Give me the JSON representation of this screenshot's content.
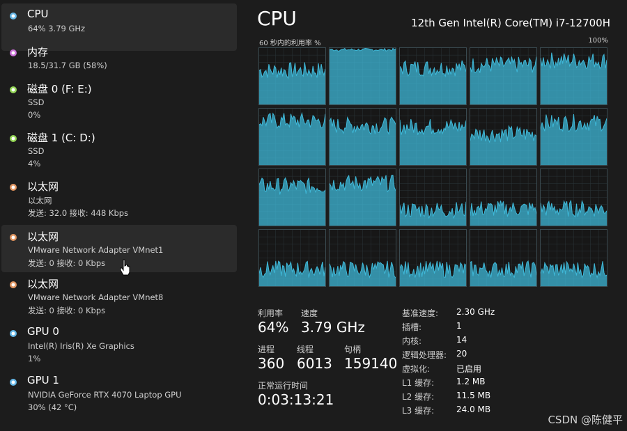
{
  "sidebar": {
    "items": [
      {
        "name": "CPU",
        "sub1": "64% 3.79 GHz",
        "sub2": "",
        "dot_color": "#5fb4e6"
      },
      {
        "name": "内存",
        "sub1": "18.5/31.7 GB (58%)",
        "sub2": "",
        "dot_color": "#c86ad6"
      },
      {
        "name": "磁盘 0 (F: E:)",
        "sub1": "SSD",
        "sub2": "0%",
        "dot_color": "#8fd44e"
      },
      {
        "name": "磁盘 1 (C: D:)",
        "sub1": "SSD",
        "sub2": "4%",
        "dot_color": "#8fd44e"
      },
      {
        "name": "以太网",
        "sub1": "以太网",
        "sub2": "发送: 32.0 接收: 448 Kbps",
        "dot_color": "#e0915a"
      },
      {
        "name": "以太网",
        "sub1": "VMware Network Adapter VMnet1",
        "sub2": "发送: 0 接收: 0 Kbps",
        "dot_color": "#e0915a"
      },
      {
        "name": "以太网",
        "sub1": "VMware Network Adapter VMnet8",
        "sub2": "发送: 0 接收: 0 Kbps",
        "dot_color": "#e0915a"
      },
      {
        "name": "GPU 0",
        "sub1": "Intel(R) Iris(R) Xe Graphics",
        "sub2": "1%",
        "dot_color": "#5fb4e6"
      },
      {
        "name": "GPU 1",
        "sub1": "NVIDIA GeForce RTX 4070 Laptop GPU",
        "sub2": "30% (42 °C)",
        "dot_color": "#5fb4e6"
      }
    ]
  },
  "main": {
    "title": "CPU",
    "model": "12th Gen Intel(R) Core(TM) i7-12700H",
    "graph_label": "60 秒内的利用率 %",
    "graph_max": "100%",
    "graph_color": "#3fb8d8",
    "core_loads": [
      0.6,
      0.97,
      0.65,
      0.7,
      0.78,
      0.78,
      0.7,
      0.68,
      0.55,
      0.75,
      0.7,
      0.75,
      0.28,
      0.3,
      0.3,
      0.3,
      0.3,
      0.3,
      0.3,
      0.3
    ]
  },
  "stats": {
    "util_label": "利用率",
    "util_value": "64%",
    "speed_label": "速度",
    "speed_value": "3.79 GHz",
    "proc_label": "进程",
    "proc_value": "360",
    "thread_label": "线程",
    "thread_value": "6013",
    "handle_label": "句柄",
    "handle_value": "159140",
    "uptime_label": "正常运行时间",
    "uptime_value": "0:03:13:21"
  },
  "specs": [
    {
      "key": "基准速度:",
      "val": "2.30 GHz"
    },
    {
      "key": "插槽:",
      "val": "1"
    },
    {
      "key": "内核:",
      "val": "14"
    },
    {
      "key": "逻辑处理器:",
      "val": "20"
    },
    {
      "key": "虚拟化:",
      "val": "已启用"
    },
    {
      "key": "L1 缓存:",
      "val": "1.2 MB"
    },
    {
      "key": "L2 缓存:",
      "val": "11.5 MB"
    },
    {
      "key": "L3 缓存:",
      "val": "24.0 MB"
    }
  ],
  "watermark": "CSDN @陈健平"
}
